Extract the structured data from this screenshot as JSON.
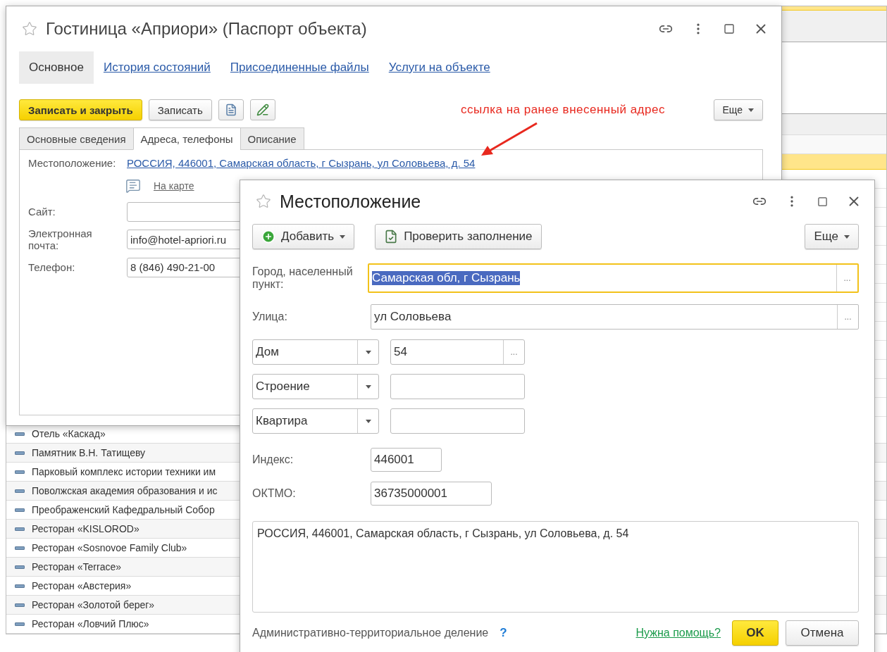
{
  "background_list": {
    "rows": [
      "Отель «Каскад»",
      "Памятник В.Н. Татищеву",
      "Парковый комплекс истории техники им",
      "Поволжская академия образования и ис",
      "Преображенский Кафедральный Собор",
      "Ресторан «KISLOROD»",
      "Ресторан «Sosnovoe Family Club»",
      "Ресторан «Terrace»",
      "Ресторан «Австерия»",
      "Ресторан «Золотой берег»",
      "Ресторан «Ловчий Плюс»"
    ]
  },
  "main_window": {
    "title": "Гостиница «Априори» (Паспорт объекта)",
    "nav_tabs": [
      {
        "label": "Основное",
        "selected": true
      },
      {
        "label": "История состояний",
        "selected": false
      },
      {
        "label": "Присоединенные файлы",
        "selected": false
      },
      {
        "label": "Услуги на объекте",
        "selected": false
      }
    ],
    "toolbar": {
      "save_close": "Записать и закрыть",
      "save": "Записать",
      "more": "Еще"
    },
    "form_tabs": [
      {
        "label": "Основные сведения",
        "selected": false
      },
      {
        "label": "Адреса, телефоны",
        "selected": true
      },
      {
        "label": "Описание",
        "selected": false
      }
    ],
    "location": {
      "label": "Местоположение:",
      "value": "РОССИЯ, 446001, Самарская область, г Сызрань, ул Соловьева, д. 54"
    },
    "map_link": "На карте",
    "fields": [
      {
        "label": "Сайт:"
      },
      {
        "label": "Электронная почта:",
        "value": "info@hotel-apriori.ru"
      },
      {
        "label": "Телефон:",
        "value": "8 (846) 490-21-00"
      }
    ],
    "annotation": "ссылка на ранее внесенный адрес"
  },
  "dialog": {
    "title": "Местоположение",
    "toolbar": {
      "add": "Добавить",
      "check": "Проверить заполнение",
      "more": "Еще"
    },
    "city": {
      "label": "Город, населенный пункт:",
      "value": "Самарская обл, г Сызрань",
      "picker": "...",
      "focused": true,
      "text_selected": true
    },
    "street": {
      "label": "Улица:",
      "value": "ул Соловьева",
      "picker": "..."
    },
    "parts": [
      {
        "type": "Дом",
        "value": "54",
        "picker": "..."
      },
      {
        "type": "Строение"
      },
      {
        "type": "Квартира"
      }
    ],
    "index": {
      "label": "Индекс:",
      "value": "446001"
    },
    "oktmo": {
      "label": "ОКТМО:",
      "value": "36735000001"
    },
    "address": "РОССИЯ, 446001, Самарская область, г Сызрань, ул Соловьева, д. 54",
    "footer": {
      "division": "Административно-территориальное деление",
      "help_mark": "?",
      "help_link": "Нужна помощь?",
      "ok": "OK",
      "cancel": "Отмена"
    }
  }
}
